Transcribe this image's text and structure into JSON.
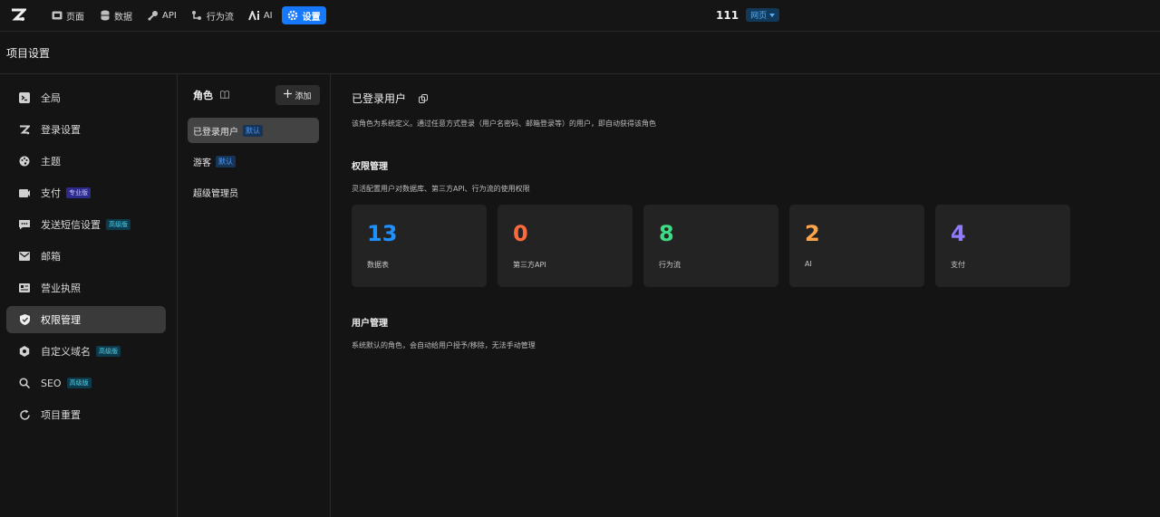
{
  "topnav": {
    "items": [
      {
        "label": "页面",
        "icon": "page-icon"
      },
      {
        "label": "数据",
        "icon": "database-icon"
      },
      {
        "label": "API",
        "icon": "api-icon"
      },
      {
        "label": "行为流",
        "icon": "flow-icon"
      },
      {
        "label": "AI",
        "icon": "ai-icon"
      },
      {
        "label": "设置",
        "icon": "gear-icon",
        "active": true
      }
    ],
    "project_name": "111",
    "project_type": "网页"
  },
  "header": {
    "title": "项目设置"
  },
  "sidebar": {
    "items": [
      {
        "label": "全局",
        "icon": "terminal-icon"
      },
      {
        "label": "登录设置",
        "icon": "logo-z-icon"
      },
      {
        "label": "主题",
        "icon": "palette-icon"
      },
      {
        "label": "支付",
        "icon": "payment-icon",
        "tag": "专业版"
      },
      {
        "label": "发送短信设置",
        "icon": "message-icon",
        "tag": "高级版"
      },
      {
        "label": "邮箱",
        "icon": "mail-icon"
      },
      {
        "label": "营业执照",
        "icon": "license-icon"
      },
      {
        "label": "权限管理",
        "icon": "shield-icon",
        "active": true
      },
      {
        "label": "自定义域名",
        "icon": "domain-icon",
        "tag": "高级版"
      },
      {
        "label": "SEO",
        "icon": "search-icon",
        "tag": "高级版"
      },
      {
        "label": "项目重置",
        "icon": "reset-icon"
      }
    ]
  },
  "roles": {
    "title": "角色",
    "add_label": "添加",
    "items": [
      {
        "label": "已登录用户",
        "tag": "默认"
      },
      {
        "label": "游客",
        "tag": "默认"
      },
      {
        "label": "超级管理员",
        "tag": ""
      }
    ]
  },
  "main": {
    "title": "已登录用户",
    "description": "该角色为系统定义。通过任意方式登录（用户名密码、邮箱登录等）的用户，即自动获得该角色",
    "permissions": {
      "title": "权限管理",
      "description": "灵活配置用户对数据库、第三方API、行为流的使用权限",
      "cards": [
        {
          "value": "13",
          "label": "数据表",
          "color": "#1e90ff"
        },
        {
          "value": "0",
          "label": "第三方API",
          "color": "#ff6a3d"
        },
        {
          "value": "8",
          "label": "行为流",
          "color": "#3ddc84"
        },
        {
          "value": "2",
          "label": "AI",
          "color": "#ffa64d"
        },
        {
          "value": "4",
          "label": "支付",
          "color": "#8f7cff"
        }
      ]
    },
    "users": {
      "title": "用户管理",
      "description": "系统默认的角色，会自动给用户授予/移除，无法手动管理"
    }
  }
}
